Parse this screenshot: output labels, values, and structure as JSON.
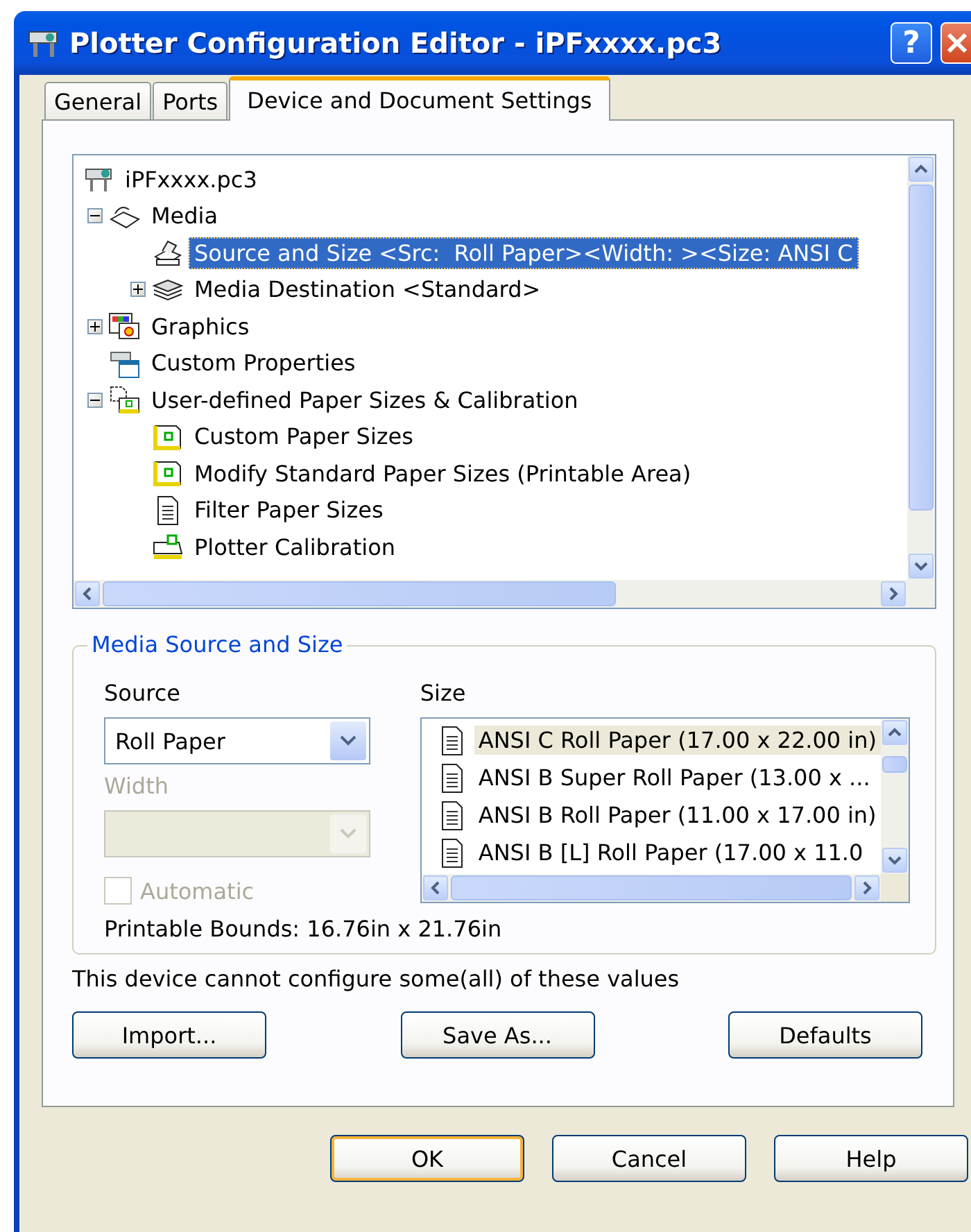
{
  "window": {
    "title": "Plotter Configuration Editor - iPFxxxx.pc3",
    "help_button": "?"
  },
  "tabs": [
    {
      "label": "General",
      "selected": false
    },
    {
      "label": "Ports",
      "selected": false
    },
    {
      "label": "Device and Document Settings",
      "selected": true
    }
  ],
  "tree": {
    "items": [
      {
        "label": "iPFxxxx.pc3",
        "kind": "plotter",
        "selected": false,
        "children": [
          {
            "label": "Media",
            "kind": "media",
            "selected": false,
            "expanded": true,
            "children": [
              {
                "label": "Source and Size <Src:  Roll Paper><Width: ><Size: ANSI C",
                "kind": "tray",
                "selected": true
              },
              {
                "label": "Media Destination <Standard>",
                "kind": "stack",
                "selected": false,
                "expanded": false
              }
            ]
          },
          {
            "label": "Graphics",
            "kind": "graphics",
            "selected": false,
            "expanded": false
          },
          {
            "label": "Custom Properties",
            "kind": "properties",
            "selected": false
          },
          {
            "label": "User-defined Paper Sizes & Calibration",
            "kind": "sizes",
            "selected": false,
            "expanded": true,
            "children": [
              {
                "label": "Custom Paper Sizes",
                "kind": "paper",
                "selected": false
              },
              {
                "label": "Modify Standard Paper Sizes (Printable Area)",
                "kind": "paper",
                "selected": false
              },
              {
                "label": "Filter Paper Sizes",
                "kind": "document",
                "selected": false
              },
              {
                "label": "Plotter Calibration",
                "kind": "calibration",
                "selected": false
              }
            ]
          }
        ]
      }
    ]
  },
  "media_source_and_size": {
    "title": "Media Source and Size",
    "source": {
      "label": "Source",
      "value": "Roll Paper",
      "disabled": false
    },
    "width": {
      "label": "Width",
      "disabled": true
    },
    "automatic": {
      "label": "Automatic",
      "checked": false,
      "disabled": true
    },
    "size": {
      "label": "Size",
      "items": [
        {
          "label": "ANSI C Roll Paper (17.00 x 22.00 in)",
          "selected": true
        },
        {
          "label": "ANSI B Super Roll Paper (13.00 x ...",
          "selected": false
        },
        {
          "label": "ANSI B Roll Paper (11.00 x 17.00 in)",
          "selected": false
        },
        {
          "label": "ANSI B [L] Roll Paper (17.00 x 11.0",
          "selected": false
        }
      ]
    },
    "printable_bounds": "Printable Bounds: 16.76in x 21.76in"
  },
  "note": "This device cannot configure some(all) of these values",
  "actions": [
    {
      "label": "Import..."
    },
    {
      "label": "Save As..."
    },
    {
      "label": "Defaults"
    }
  ],
  "buttons": [
    {
      "label": "OK",
      "default": true
    },
    {
      "label": "Cancel",
      "default": false
    },
    {
      "label": "Help",
      "default": false
    }
  ]
}
